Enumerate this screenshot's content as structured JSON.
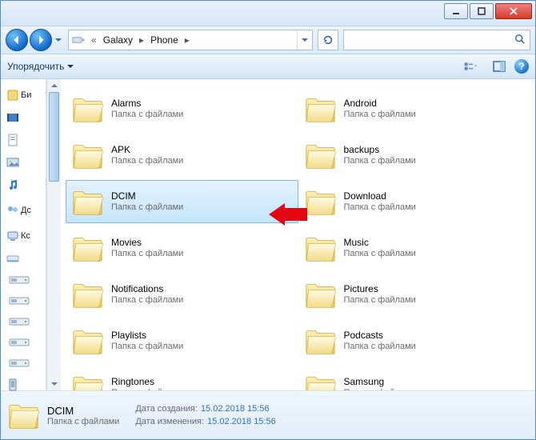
{
  "breadcrumb": {
    "seg1": "Galaxy",
    "seg2": "Phone"
  },
  "search": {
    "placeholder": ""
  },
  "toolbar": {
    "organize": "Упорядочить"
  },
  "sidebar": {
    "lib_label": "Би",
    "home_label": "Дс",
    "comp_label": "Кс"
  },
  "item_subtitle": "Папка с файлами",
  "folders": [
    {
      "name": "Alarms"
    },
    {
      "name": "Android"
    },
    {
      "name": "APK"
    },
    {
      "name": "backups"
    },
    {
      "name": "DCIM",
      "selected": true
    },
    {
      "name": "Download"
    },
    {
      "name": "Movies"
    },
    {
      "name": "Music"
    },
    {
      "name": "Notifications"
    },
    {
      "name": "Pictures"
    },
    {
      "name": "Playlists"
    },
    {
      "name": "Podcasts"
    },
    {
      "name": "Ringtones"
    },
    {
      "name": "Samsung"
    }
  ],
  "details": {
    "name": "DCIM",
    "type": "Папка с файлами",
    "created_label": "Дата создания:",
    "created_value": "15.02.2018 15:56",
    "modified_label": "Дата изменения:",
    "modified_value": "15.02.2018 15:56"
  }
}
